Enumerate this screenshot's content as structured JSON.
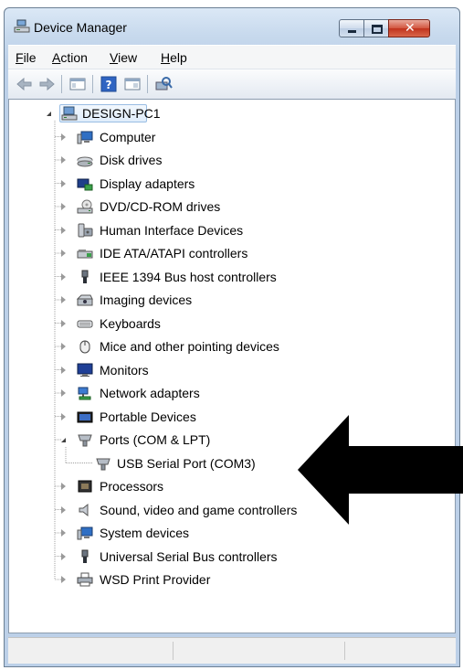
{
  "window": {
    "title": "Device Manager"
  },
  "menubar": {
    "items": [
      {
        "label": "File",
        "mnemonic": "F",
        "rest": "ile"
      },
      {
        "label": "Action",
        "mnemonic": "A",
        "rest": "ction"
      },
      {
        "label": "View",
        "mnemonic": "V",
        "rest": "iew"
      },
      {
        "label": "Help",
        "mnemonic": "H",
        "rest": "elp"
      }
    ]
  },
  "toolbar": {
    "icons": [
      "back-arrow-icon",
      "forward-arrow-icon",
      "show-hide-console-tree-icon",
      "help-icon",
      "properties-icon",
      "scan-hardware-icon"
    ]
  },
  "tree": {
    "root": {
      "label": "DESIGN-PC1",
      "icon": "computer-network-icon",
      "expanded": true
    },
    "items": [
      {
        "label": "Computer",
        "icon": "computer-icon",
        "expanded": false
      },
      {
        "label": "Disk drives",
        "icon": "disk-drive-icon",
        "expanded": false
      },
      {
        "label": "Display adapters",
        "icon": "display-adapter-icon",
        "expanded": false
      },
      {
        "label": "DVD/CD-ROM drives",
        "icon": "dvd-drive-icon",
        "expanded": false
      },
      {
        "label": "Human Interface Devices",
        "icon": "hid-icon",
        "expanded": false
      },
      {
        "label": "IDE ATA/ATAPI controllers",
        "icon": "ide-controller-icon",
        "expanded": false
      },
      {
        "label": "IEEE 1394 Bus host controllers",
        "icon": "firewire-icon",
        "expanded": false
      },
      {
        "label": "Imaging devices",
        "icon": "imaging-device-icon",
        "expanded": false
      },
      {
        "label": "Keyboards",
        "icon": "keyboard-icon",
        "expanded": false
      },
      {
        "label": "Mice and other pointing devices",
        "icon": "mouse-icon",
        "expanded": false
      },
      {
        "label": "Monitors",
        "icon": "monitor-icon",
        "expanded": false
      },
      {
        "label": "Network adapters",
        "icon": "network-adapter-icon",
        "expanded": false
      },
      {
        "label": "Portable Devices",
        "icon": "portable-device-icon",
        "expanded": false
      },
      {
        "label": "Ports (COM & LPT)",
        "icon": "port-icon",
        "expanded": true,
        "children": [
          {
            "label": "USB Serial Port (COM3)",
            "icon": "serial-port-icon"
          }
        ]
      },
      {
        "label": "Processors",
        "icon": "processor-icon",
        "expanded": false
      },
      {
        "label": "Sound, video and game controllers",
        "icon": "sound-icon",
        "expanded": false
      },
      {
        "label": "System devices",
        "icon": "system-device-icon",
        "expanded": false
      },
      {
        "label": "Universal Serial Bus controllers",
        "icon": "usb-icon",
        "expanded": false
      },
      {
        "label": "WSD Print Provider",
        "icon": "printer-icon",
        "expanded": false
      }
    ]
  },
  "annotation": {
    "icon": "black-arrow-icon",
    "color": "#000000"
  }
}
